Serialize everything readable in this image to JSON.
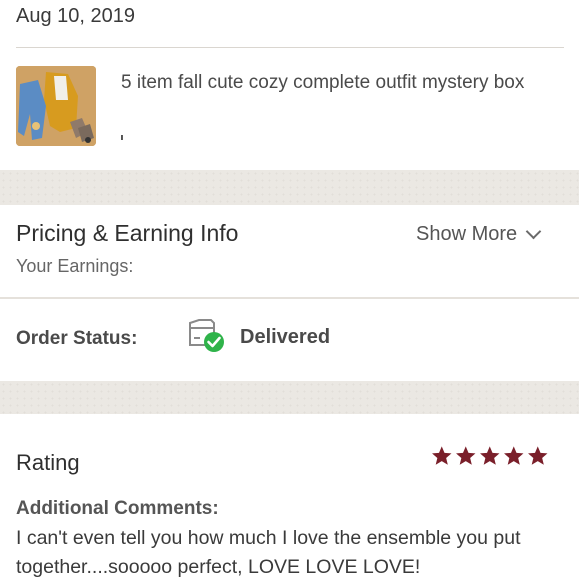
{
  "order": {
    "date": "Aug 10, 2019",
    "item_title": "5 item fall cute cozy complete outfit mystery box",
    "item_image_icon": "outfit-thumbnail"
  },
  "pricing": {
    "title": "Pricing & Earning Info",
    "earnings_label": "Your Earnings:",
    "show_more_label": "Show More",
    "show_more_icon": "chevron-down-icon"
  },
  "status": {
    "label": "Order Status:",
    "value": "Delivered",
    "icon": "delivered-box-check-icon",
    "icon_color": "#2fb34a"
  },
  "rating": {
    "label": "Rating",
    "stars": 5,
    "max_stars": 5,
    "star_color": "#7a1f2a",
    "comments_label": "Additional Comments:",
    "comments": "I can't even tell you how much I love the ensemble you put together....sooooo perfect, LOVE LOVE LOVE!"
  }
}
